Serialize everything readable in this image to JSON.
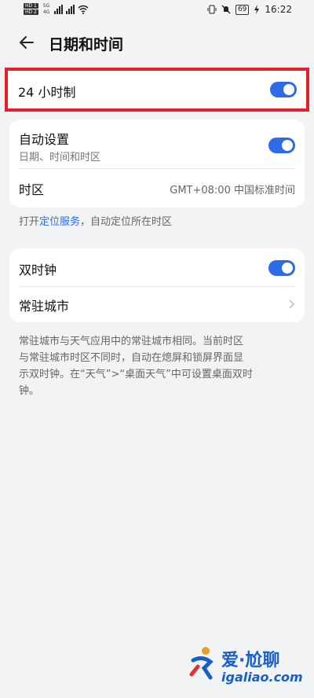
{
  "status_bar": {
    "sim1": "HD 1",
    "sim2": "HD 2",
    "net1": "5G",
    "net2": "4G",
    "battery": "69",
    "time": "16:22"
  },
  "header": {
    "title": "日期和时间"
  },
  "hour24": {
    "label": "24 小时制",
    "enabled": true
  },
  "auto": {
    "label": "自动设置",
    "sub": "日期、时间和时区",
    "enabled": true
  },
  "timezone": {
    "label": "时区",
    "value": "GMT+08:00 中国标准时间"
  },
  "location_hint": {
    "prefix": "打开",
    "link": "定位服务",
    "suffix": "，自动定位所在时区"
  },
  "dual_clock": {
    "label": "双时钟",
    "enabled": true
  },
  "home_city": {
    "label": "常驻城市"
  },
  "dual_hint": {
    "line1": "常驻城市与天气应用中的常驻城市相同。当前时区",
    "line2": "与常驻城市时区不同时，自动在熄屏和锁屏界面显",
    "line3": "示双时钟。在“天气”>“桌面天气”中可设置桌面双时",
    "line4": "钟。"
  },
  "watermark": {
    "text": "爱·尬聊",
    "url": "igaliao.com"
  },
  "colors": {
    "accent": "#2e6be6",
    "highlight": "#e0202a",
    "background": "#f1f3f5"
  }
}
